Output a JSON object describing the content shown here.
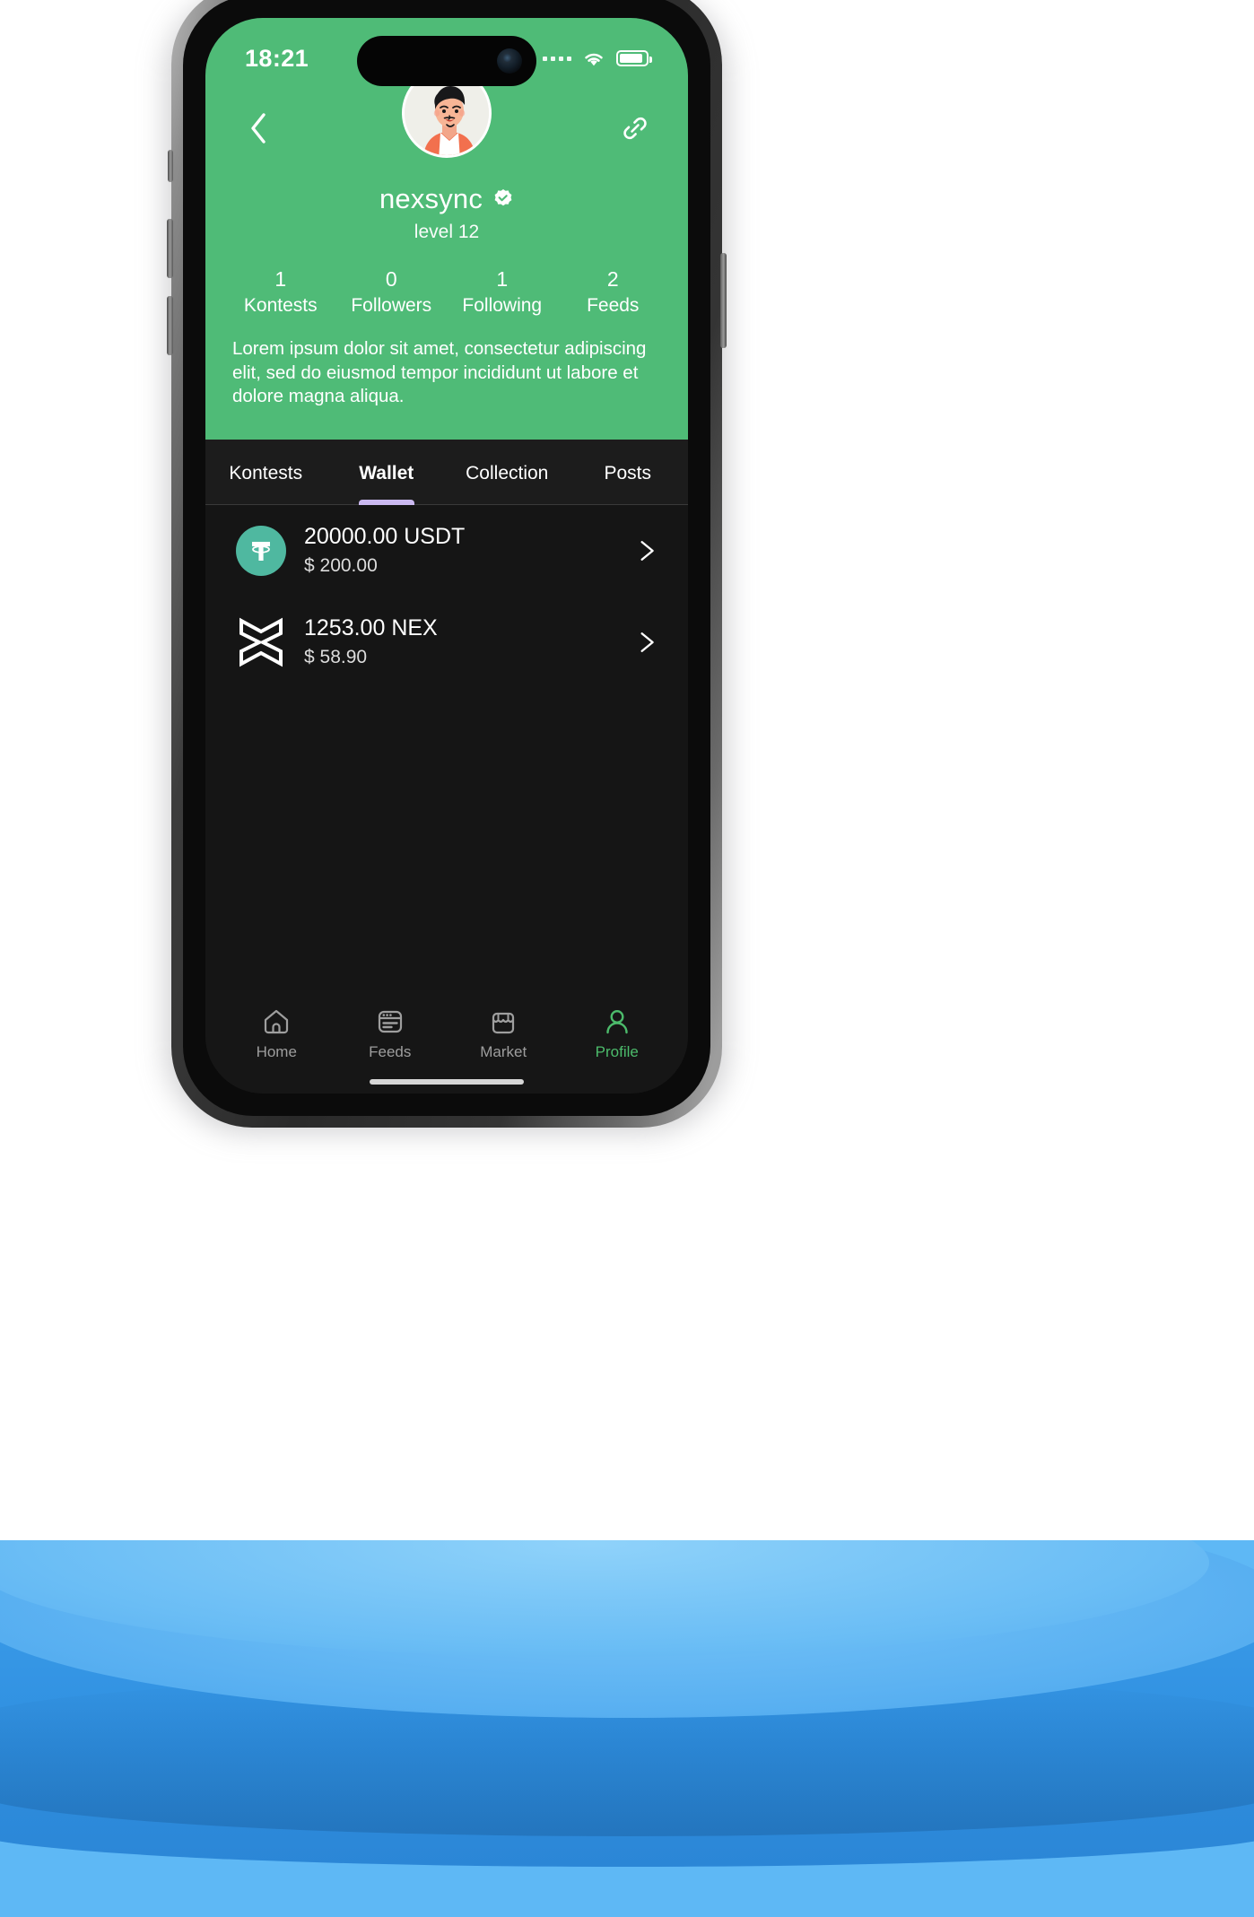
{
  "statusbar": {
    "time": "18:21",
    "signal_icon": "signal-dots-icon",
    "wifi_icon": "wifi-icon",
    "battery_icon": "battery-icon"
  },
  "header": {
    "back_icon": "chevron-left-icon",
    "link_icon": "link-chain-icon",
    "avatar_alt": "user-avatar-illustration",
    "username": "nexsync",
    "verified_icon": "verified-badge-icon",
    "level": "level 12",
    "bio": "Lorem ipsum dolor sit amet, consectetur adipiscing elit, sed do eiusmod tempor incididunt ut labore et dolore magna aliqua.",
    "background_color": "#4FBB77",
    "stats": [
      {
        "value": "1",
        "label": "Kontests"
      },
      {
        "value": "0",
        "label": "Followers"
      },
      {
        "value": "1",
        "label": "Following"
      },
      {
        "value": "2",
        "label": "Feeds"
      }
    ]
  },
  "tabs": {
    "active_index": 1,
    "indicator_color": "#CBB9F0",
    "items": [
      {
        "label": "Kontests"
      },
      {
        "label": "Wallet"
      },
      {
        "label": "Collection"
      },
      {
        "label": "Posts"
      }
    ]
  },
  "wallet": {
    "rows": [
      {
        "icon": "tether-usdt-icon",
        "icon_color": "#4FB8A0",
        "amount": "20000.00 USDT",
        "usd_value": "$ 200.00",
        "chevron": "chevron-right-icon"
      },
      {
        "icon": "nex-token-icon",
        "icon_color": "#FFFFFF",
        "amount": "1253.00 NEX",
        "usd_value": "$ 58.90",
        "chevron": "chevron-right-icon"
      }
    ]
  },
  "bottom_nav": {
    "active_index": 3,
    "active_color": "#4CBB6B",
    "inactive_color": "#9E9E9E",
    "items": [
      {
        "label": "Home",
        "icon": "home-icon"
      },
      {
        "label": "Feeds",
        "icon": "feeds-window-icon"
      },
      {
        "label": "Market",
        "icon": "market-store-icon"
      },
      {
        "label": "Profile",
        "icon": "person-icon"
      }
    ]
  },
  "podium": {
    "top_color": "#6ABDF5",
    "body_color": "#2F8FE0",
    "bg_color": "#5EB8F5"
  }
}
